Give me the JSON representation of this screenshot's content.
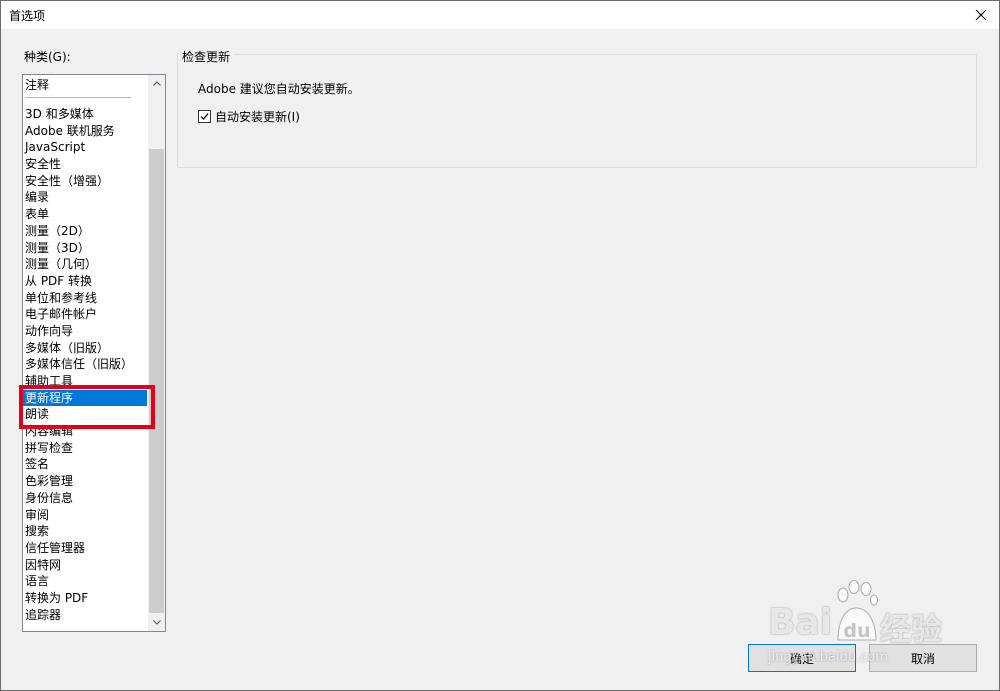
{
  "window": {
    "title": "首选项"
  },
  "category": {
    "label": "种类(G):",
    "items": [
      "注释",
      "3D 和多媒体",
      "Adobe 联机服务",
      "JavaScript",
      "安全性",
      "安全性（增强）",
      "编录",
      "表单",
      "测量（2D）",
      "测量（3D）",
      "测量（几何）",
      "从 PDF 转换",
      "单位和参考线",
      "电子邮件帐户",
      "动作向导",
      "多媒体（旧版）",
      "多媒体信任（旧版）",
      "辅助工具",
      "更新程序",
      "朗读",
      "内容编辑",
      "拼写检查",
      "签名",
      "色彩管理",
      "身份信息",
      "审阅",
      "搜索",
      "信任管理器",
      "因特网",
      "语言",
      "转换为 PDF",
      "追踪器"
    ],
    "selected_index": 18
  },
  "updates": {
    "group_title": "检查更新",
    "recommend": "Adobe 建议您自动安装更新。",
    "auto_install_label": "自动安装更新(I)",
    "auto_install_checked": true
  },
  "buttons": {
    "ok": "确定",
    "cancel": "取消"
  },
  "watermark": {
    "brand": "Bai",
    "paw": "du",
    "suffix": "经验",
    "url": "jingyan.baidu.com"
  },
  "colors": {
    "selection": "#0078d7",
    "highlight": "#e4001b"
  }
}
